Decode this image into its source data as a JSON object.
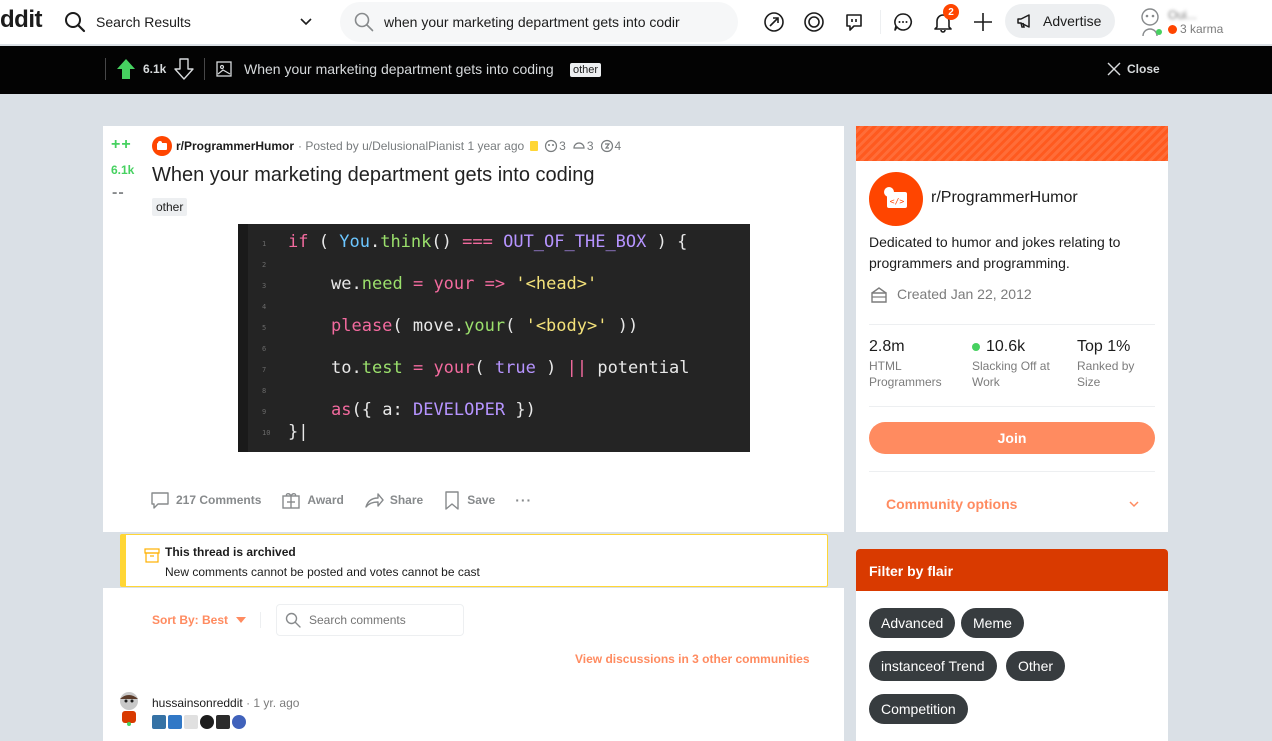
{
  "header": {
    "logo_fragment": "ddit",
    "feed_label": "Search Results",
    "search_value": "when your marketing department gets into codir",
    "notification_count": "2",
    "advertise_label": "Advertise",
    "karma_text": "3 karma",
    "username_blurred": "Oui..."
  },
  "postbar": {
    "score": "6.1k",
    "title": "When your marketing department gets into coding",
    "flair": "other",
    "close_label": "Close"
  },
  "post": {
    "vote_up_symbol": "++",
    "score": "6.1k",
    "vote_down_symbol": "--",
    "subreddit": "r/ProgrammerHumor",
    "posted_by": "· Posted by u/DelusionalPianist 1 year ago",
    "awards": [
      {
        "icon": "award-icon-a",
        "count": "3"
      },
      {
        "icon": "award-icon-b",
        "count": "3"
      },
      {
        "icon": "award-icon-c",
        "count": "4"
      }
    ],
    "title": "When your marketing department gets into coding",
    "flair": "other",
    "code_lines": [
      {
        "num": "1",
        "text": "if ( You.think() === OUT_OF_THE_BOX ) {"
      },
      {
        "num": "2",
        "text": ""
      },
      {
        "num": "3",
        "text": "we.need = your => '<head>'"
      },
      {
        "num": "4",
        "text": ""
      },
      {
        "num": "5",
        "text": "please( move.your( '<body>' ))"
      },
      {
        "num": "6",
        "text": ""
      },
      {
        "num": "7",
        "text": "to.test = your( true ) || potential"
      },
      {
        "num": "8",
        "text": ""
      },
      {
        "num": "9",
        "text": "as({ a: DEVELOPER })"
      },
      {
        "num": "10",
        "text": "}|"
      }
    ],
    "actions": {
      "comments": "217 Comments",
      "award": "Award",
      "share": "Share",
      "save": "Save",
      "more": "···"
    }
  },
  "about": {
    "name": "r/ProgrammerHumor",
    "description": "Dedicated to humor and jokes relating to programmers and programming.",
    "created": "Created Jan 22, 2012",
    "stats": [
      {
        "value": "2.8m",
        "label": "HTML Programmers"
      },
      {
        "value": "10.6k",
        "label": "Slacking Off at Work"
      },
      {
        "value": "Top 1%",
        "label": "Ranked by Size"
      }
    ],
    "join_label": "Join",
    "community_options": "Community options"
  },
  "archived": {
    "title": "This thread is archived",
    "subtitle": "New comments cannot be posted and votes cannot be cast"
  },
  "comments": {
    "sort_label": "Sort By: Best",
    "search_placeholder": "Search comments",
    "view_discussions": "View discussions in 3 other communities",
    "first_comment": {
      "user": "hussainsonreddit",
      "time": "· 1 yr. ago"
    }
  },
  "flair_filter": {
    "title": "Filter by flair",
    "tags": [
      "Advanced",
      "Meme",
      "instanceof Trend",
      "Other",
      "Competition"
    ]
  },
  "colors": {
    "accent": "#ff4500",
    "upvote_green": "#46d160",
    "join_orange": "#ff8b60",
    "flair_header": "#d93a00",
    "archived_border": "#ffd635"
  }
}
